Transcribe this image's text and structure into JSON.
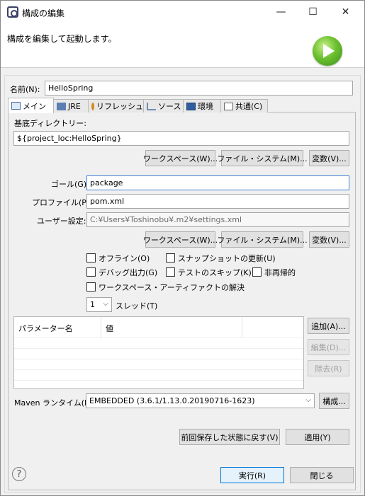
{
  "window": {
    "title": "構成の編集",
    "minimize": "—",
    "maximize": "☐",
    "close": "✕"
  },
  "header": {
    "message": "構成を編集して起動します。",
    "banner_icon": "run-icon"
  },
  "name": {
    "label": "名前(N):",
    "value": "HelloSpring"
  },
  "tabs": [
    {
      "label": "メイン",
      "icon": "main-tab-icon",
      "active": true
    },
    {
      "label": "JRE",
      "icon": "jre-icon"
    },
    {
      "label": "リフレッシュ",
      "icon": "refresh-icon"
    },
    {
      "label": "ソース",
      "icon": "source-icon"
    },
    {
      "label": "環境",
      "icon": "environment-icon"
    },
    {
      "label": "共通(C)",
      "icon": "common-icon"
    }
  ],
  "main": {
    "base_dir_label": "基底ディレクトリー:",
    "base_dir_value": "${project_loc:HelloSpring}",
    "workspace_btn": "ワークスペース(W)...",
    "filesystem_btn": "ファイル・システム(M)...",
    "variables_btn": "変数(V)...",
    "goals_label": "ゴール(G):",
    "goals_value": "package",
    "profiles_label": "プロファイル(P):",
    "profiles_value": "pom.xml",
    "user_settings_label": "ユーザー設定:",
    "user_settings_value": "C:¥Users¥Toshinobu¥.m2¥settings.xml",
    "workspace_btn2": "ワークスペース(W)...",
    "filesystem_btn2": "ファイル・システム(M)...",
    "variables_btn2": "変数(V)...",
    "checkboxes": {
      "offline": "オフライン(O)",
      "update_snapshots": "スナップショットの更新(U)",
      "debug_output": "デバッグ出力(G)",
      "skip_tests": "テストのスキップ(K)",
      "non_recursive": "非再帰的",
      "resolve_workspace": "ワークスペース・アーティファクトの解決"
    },
    "threads_value": "1",
    "threads_label": "スレッド(T)",
    "param_table": {
      "col_name": "パラメーター名",
      "col_value": "値"
    },
    "add_btn": "追加(A)...",
    "edit_btn": "編集(D)...",
    "remove_btn": "除去(R)",
    "maven_runtime_label": "Maven ランタイム(I):",
    "maven_runtime_value": "EMBEDDED (3.6.1/1.13.0.20190716-1623)",
    "configure_btn": "構成..."
  },
  "footer": {
    "revert_btn": "前回保存した状態に戻す(V)",
    "apply_btn": "適用(Y)",
    "run_btn": "実行(R)",
    "close_btn": "閉じる",
    "help_glyph": "?"
  }
}
